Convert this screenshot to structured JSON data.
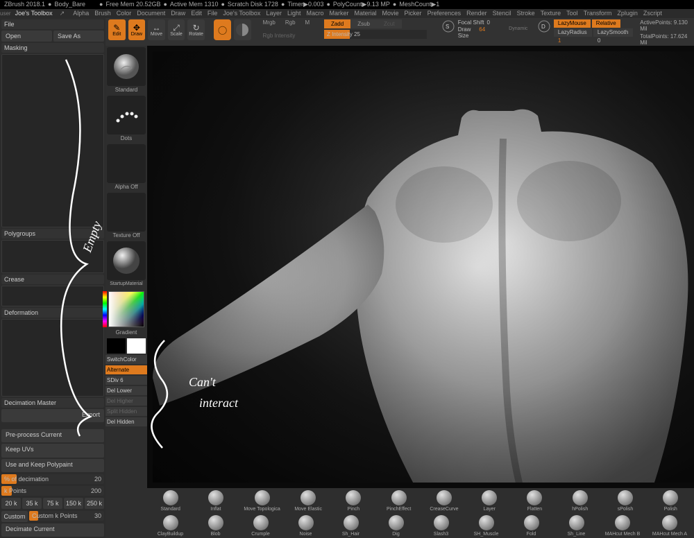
{
  "titlebar": {
    "app": "ZBrush 2018.1",
    "doc": "Body_Bare",
    "free_mem": "Free Mem 20.52GB",
    "active_mem": "Active Mem 1310",
    "scratch": "Scratch Disk 1728",
    "timer": "Timer▶0.003",
    "polycount": "PolyCount▶9.13 MP",
    "meshcount": "MeshCount▶1"
  },
  "menubar": {
    "user": "user",
    "toolbox": "Joe's Toolbox",
    "items": [
      "Alpha",
      "Brush",
      "Color",
      "Document",
      "Draw",
      "Edit",
      "File",
      "Joe's Toolbox",
      "Layer",
      "Light",
      "Macro",
      "Marker",
      "Material",
      "Movie",
      "Picker",
      "Preferences",
      "Render",
      "Stencil",
      "Stroke",
      "Texture",
      "Tool",
      "Transform",
      "Zplugin",
      "Zscript"
    ]
  },
  "left": {
    "file_label": "File",
    "open": "Open",
    "saveas": "Save As",
    "masking": "Masking",
    "polygroups": "Polygroups",
    "crease": "Crease",
    "deformation": "Deformation",
    "decimation_master": "Decimation Master",
    "export": "Export",
    "preprocess": "Pre-process Current",
    "keep_uvs": "Keep UVs",
    "use_polypaint": "Use and Keep Polypaint",
    "pct_decimation_label": "% of decimation",
    "pct_decimation_value": "20",
    "kpoints_label": "k Points",
    "kpoints_value": "200",
    "presets": [
      "20 k",
      "35 k",
      "75 k",
      "150 k",
      "250 k"
    ],
    "custom": "Custom",
    "custom_k_label": "Custom k Points",
    "custom_k_value": "30",
    "decimate_current": "Decimate Current"
  },
  "top_tools": {
    "edit": "Edit",
    "draw": "Draw",
    "move": "Move",
    "scale": "Scale",
    "rotate": "Rotate",
    "mrgb": "Mrgb",
    "rgb": "Rgb",
    "m": "M",
    "rgb_intensity": "Rgb Intensity",
    "zadd": "Zadd",
    "zsub": "Zsub",
    "zcut": "Zcut",
    "z_intensity_label": "Z Intensity",
    "z_intensity_value": "25",
    "focal_shift_label": "Focal Shift",
    "focal_shift_value": "0",
    "draw_size_label": "Draw Size",
    "draw_size_value": "64",
    "dynamic": "Dynamic",
    "lazymouse": "LazyMouse",
    "relative": "Relative",
    "lazyradius_label": "LazyRadius",
    "lazyradius_value": "1",
    "lazysmooth_label": "LazySmooth",
    "lazysmooth_value": "0",
    "active_points_label": "ActivePoints:",
    "active_points_value": "9.130 Mil",
    "total_points_label": "TotalPoints:",
    "total_points_value": "17.624 Mil"
  },
  "tray": {
    "brush": "Standard",
    "stroke": "Dots",
    "alpha": "Alpha Off",
    "texture": "Texture Off",
    "material": "StartupMaterial",
    "gradient": "Gradient",
    "switchcolor": "SwitchColor",
    "alternate": "Alternate",
    "sdiv_label": "SDiv",
    "sdiv_value": "6",
    "del_lower": "Del Lower",
    "del_higher": "Del Higher",
    "split_hidden": "Split Hidden",
    "del_hidden": "Del Hidden"
  },
  "brush_bar": {
    "row1": [
      "Standard",
      "Inflat",
      "Move Topologica",
      "Move Elastic",
      "Pinch",
      "PinchEffect",
      "CreaseCurve",
      "Layer",
      "Flatten",
      "hPolish",
      "sPolish",
      "Polish"
    ],
    "row2": [
      "ClayBuildup",
      "Blob",
      "Crumple",
      "Noise",
      "Sh_Hair",
      "Dig",
      "Slash3",
      "SH_Muscle",
      "Fold",
      "Sh_Line",
      "MAHcut Mech B",
      "MAHcut Mech A"
    ]
  },
  "annotations": {
    "empty": "Empty",
    "cant_interact_1": "Can't",
    "cant_interact_2": "interact"
  }
}
